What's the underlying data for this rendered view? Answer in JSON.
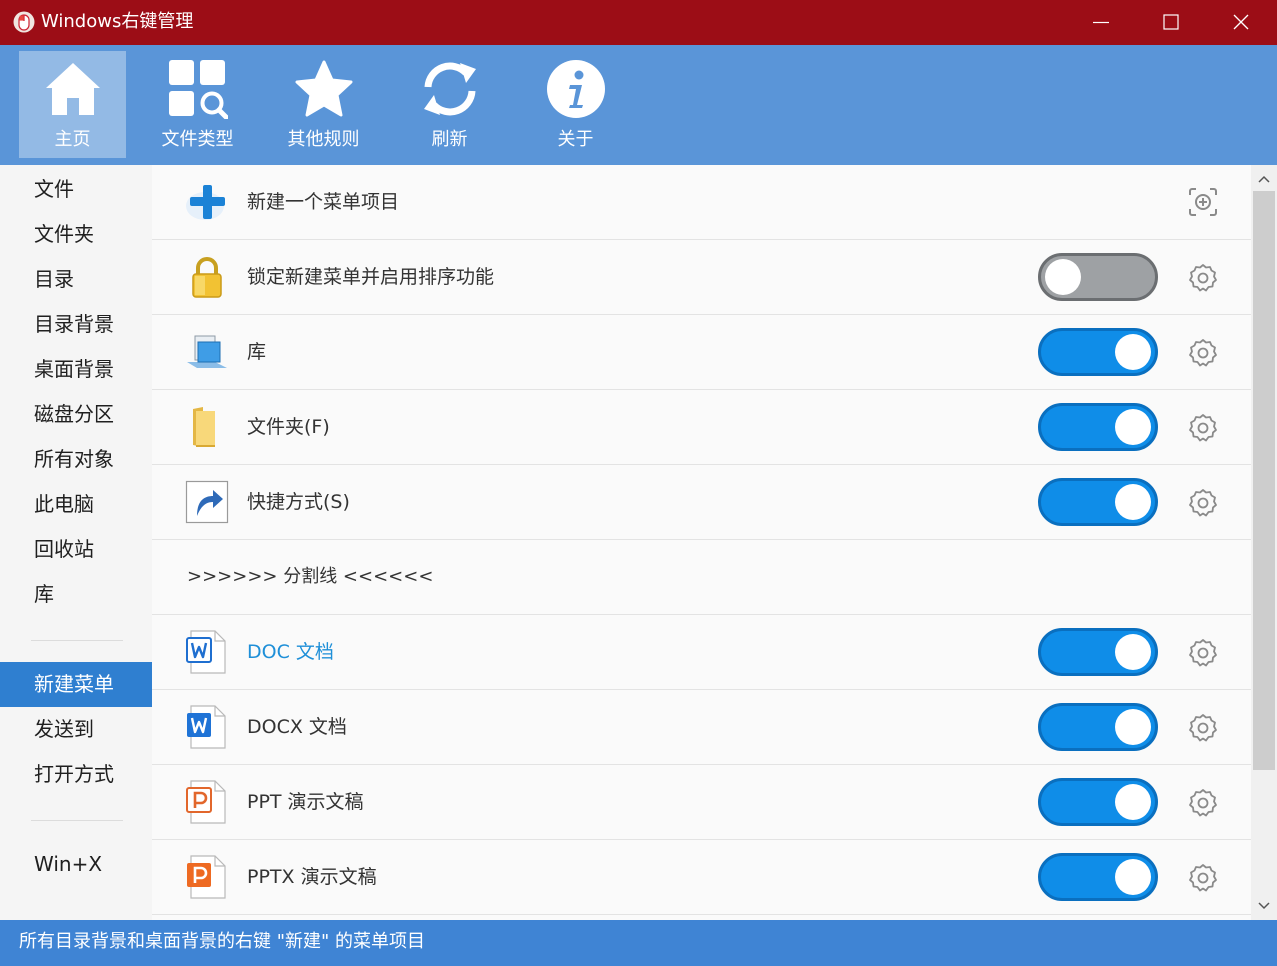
{
  "window": {
    "title": "Windows右键管理"
  },
  "toolbar": {
    "items": [
      {
        "label": "主页",
        "icon": "home-icon",
        "active": true
      },
      {
        "label": "文件类型",
        "icon": "file-types-icon"
      },
      {
        "label": "其他规则",
        "icon": "star-icon"
      },
      {
        "label": "刷新",
        "icon": "refresh-icon"
      },
      {
        "label": "关于",
        "icon": "info-icon"
      }
    ]
  },
  "sidebar": {
    "items": [
      {
        "label": "文件"
      },
      {
        "label": "文件夹"
      },
      {
        "label": "目录"
      },
      {
        "label": "目录背景"
      },
      {
        "label": "桌面背景"
      },
      {
        "label": "磁盘分区"
      },
      {
        "label": "所有对象"
      },
      {
        "label": "此电脑"
      },
      {
        "label": "回收站"
      },
      {
        "label": "库"
      },
      {
        "label": "新建菜单",
        "selected": true
      },
      {
        "label": "发送到"
      },
      {
        "label": "打开方式"
      },
      {
        "label": "Win+X"
      }
    ]
  },
  "list": {
    "new_item": {
      "label": "新建一个菜单项目",
      "icon": "plus-icon"
    },
    "rows": [
      {
        "label": "锁定新建菜单并启用排序功能",
        "icon": "lock-icon",
        "enabled": false
      },
      {
        "label": "库",
        "icon": "library-icon",
        "enabled": true
      },
      {
        "label": "文件夹(F)",
        "icon": "folder-icon",
        "enabled": true
      },
      {
        "label": "快捷方式(S)",
        "icon": "shortcut-icon",
        "enabled": true
      },
      {
        "label": ">>>>>> 分割线 <<<<<<",
        "separator": true
      },
      {
        "label": "DOC 文档",
        "icon": "doc-icon",
        "enabled": true,
        "highlight": true
      },
      {
        "label": "DOCX 文档",
        "icon": "docx-icon",
        "enabled": true
      },
      {
        "label": "PPT 演示文稿",
        "icon": "ppt-icon",
        "enabled": true
      },
      {
        "label": "PPTX 演示文稿",
        "icon": "pptx-icon",
        "enabled": true
      }
    ]
  },
  "status": {
    "text": "所有目录背景和桌面背景的右键 \"新建\" 的菜单项目"
  },
  "colors": {
    "titlebar": "#9c0d16",
    "toolbar": "#5a95d8",
    "statusbar": "#3f84d4",
    "sidebar_selected": "#2f7fd0",
    "toggle_on": "#0f8de8",
    "toggle_off": "#9ea1a4",
    "link": "#1e8fd8"
  }
}
